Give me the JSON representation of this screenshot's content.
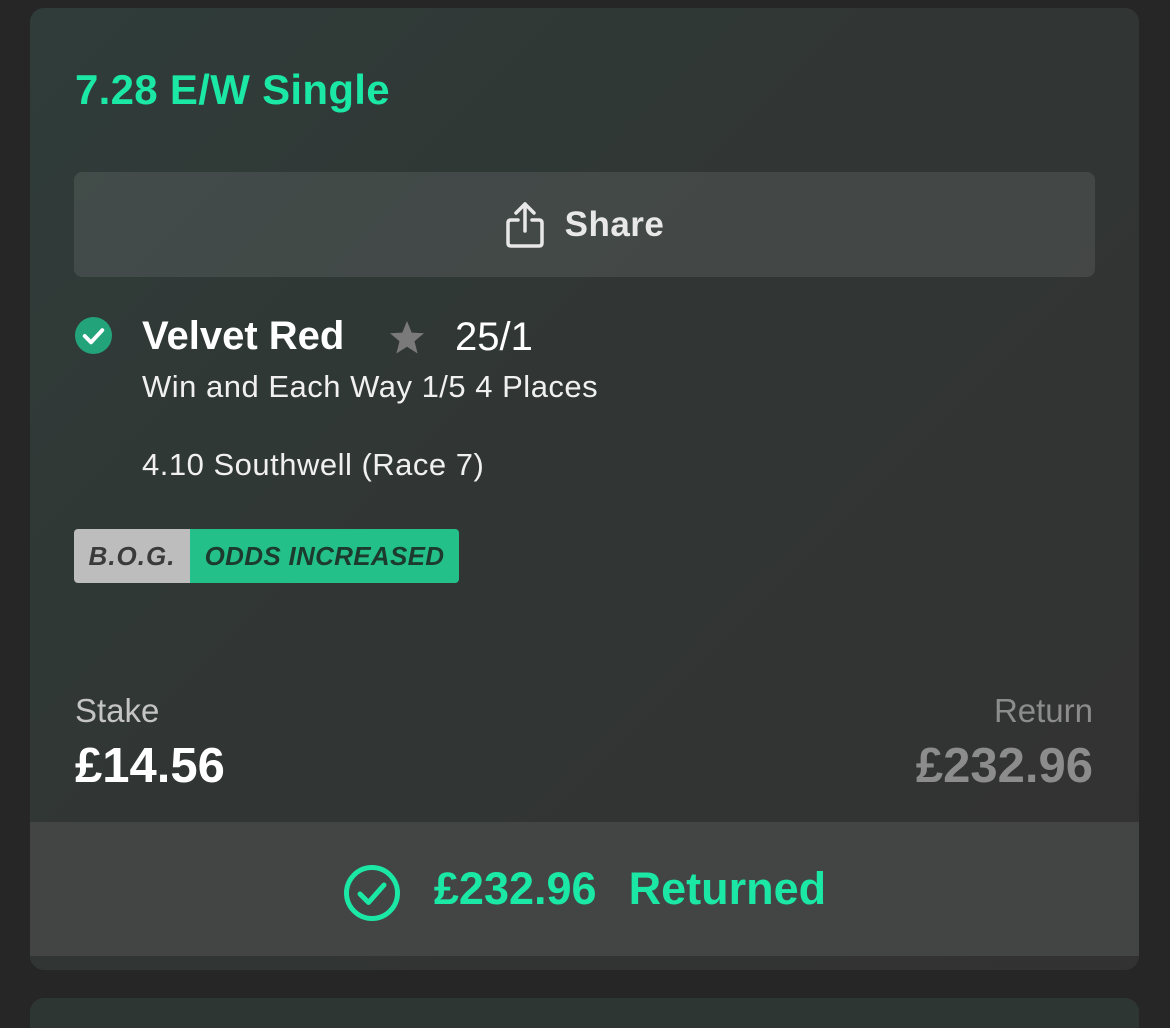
{
  "bet": {
    "title": "7.28 E/W Single"
  },
  "share": {
    "label": "Share",
    "icon": "share-icon"
  },
  "selection": {
    "status_icon": "check-circle-icon",
    "name": "Velvet Red",
    "favourite_icon": "star-icon",
    "odds": "25/1",
    "market": "Win and Each Way 1/5 4 Places",
    "event": "4.10 Southwell (Race 7)"
  },
  "badges": {
    "bog": "B.O.G.",
    "odds_increased": "ODDS INCREASED"
  },
  "stake": {
    "label": "Stake",
    "value": "£14.56"
  },
  "return": {
    "label": "Return",
    "value": "£232.96"
  },
  "result": {
    "icon": "check-circle-outline-icon",
    "amount": "£232.96",
    "status": "Returned"
  },
  "colors": {
    "accent": "#1ae8a4",
    "badge_green": "#23c08a",
    "badge_grey": "#bdbdbd"
  }
}
